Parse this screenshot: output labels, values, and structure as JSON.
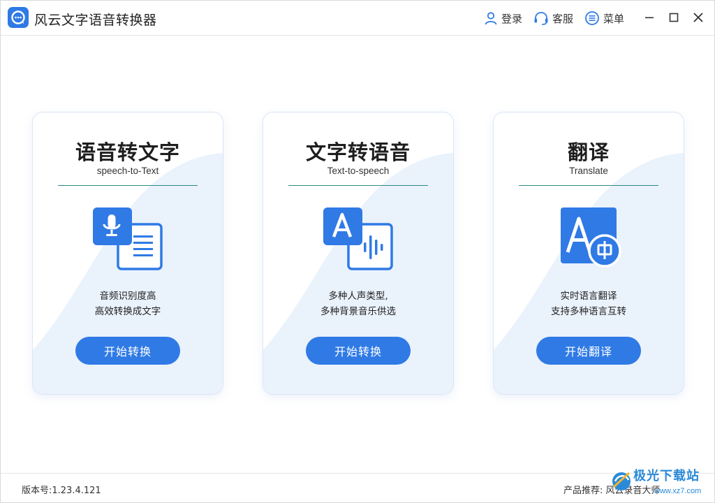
{
  "app": {
    "title": "风云文字语音转换器"
  },
  "titlebar": {
    "login_label": "登录",
    "service_label": "客服",
    "menu_label": "菜单"
  },
  "cards": [
    {
      "title": "语音转文字",
      "subtitle": "speech-to-Text",
      "desc_line1": "音频识别度高",
      "desc_line2": "高效转换成文字",
      "button_label": "开始转换",
      "icon": "speech-to-text-icon"
    },
    {
      "title": "文字转语音",
      "subtitle": "Text-to-speech",
      "desc_line1": "多种人声类型,",
      "desc_line2": "多种背景音乐供选",
      "button_label": "开始转换",
      "icon": "text-to-speech-icon"
    },
    {
      "title": "翻译",
      "subtitle": "Translate",
      "desc_line1": "实时语言翻译",
      "desc_line2": "支持多种语言互转",
      "button_label": "开始翻译",
      "icon": "translate-icon"
    }
  ],
  "statusbar": {
    "version": "版本号:1.23.4.121",
    "recommend_label": "产品推荐:",
    "recommend_link": "风云录音大师"
  },
  "watermark": {
    "text": "极光下载站",
    "url": "www.xz7.com"
  },
  "colors": {
    "accent": "#2f7ae5",
    "rule": "#2d8a86",
    "wave": "#eaf2fc"
  }
}
